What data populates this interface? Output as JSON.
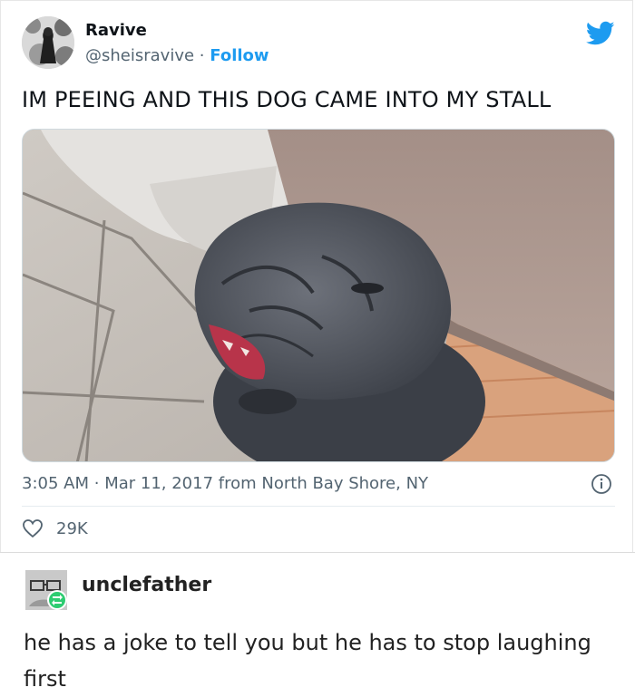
{
  "tweet": {
    "name": "Ravive",
    "handle": "@sheisravive",
    "separator": "·",
    "follow_label": "Follow",
    "text": "IM PEEING AND THIS DOG CAME INTO MY STALL",
    "time": "3:05 AM",
    "date": "Mar 11, 2017",
    "location": "from North Bay Shore, NY",
    "likes": "29K",
    "brand_color": "#1d9bf0",
    "icons": [
      "twitter-bird-icon",
      "info-icon",
      "heart-icon"
    ]
  },
  "post": {
    "username": "unclefather",
    "text": "he has a joke to tell you but he has to stop laughing first",
    "reblog_color": "#2ecc71",
    "icons": [
      "reblog-icon"
    ]
  }
}
